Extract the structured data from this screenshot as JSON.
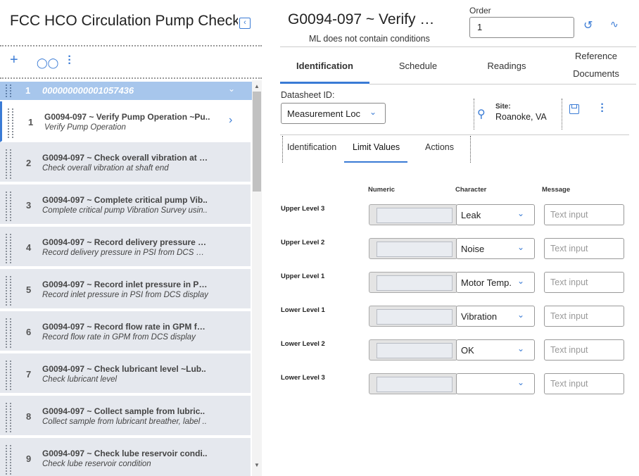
{
  "left_panel": {
    "title": "FCC HCO Circulation Pump Check…",
    "group": {
      "number": "1",
      "id": "000000000001057436"
    },
    "items": [
      {
        "number": "1",
        "title": "G0094-097 ~ Verify Pump Operation ~Pu..",
        "subtitle": "Verify Pump Operation"
      },
      {
        "number": "2",
        "title": "G0094-097 ~ Check overall vibration at s..",
        "subtitle": "Check overall vibration at shaft end"
      },
      {
        "number": "3",
        "title": "G0094-097 ~ Complete critical pump Vib..",
        "subtitle": "Complete critical pump Vibration Survey usin.."
      },
      {
        "number": "4",
        "title": "G0094-097 ~ Record delivery pressure in..",
        "subtitle": "Record delivery pressure in PSI from DCS disp.."
      },
      {
        "number": "5",
        "title": "G0094-097 ~ Record inlet pressure in PS..",
        "subtitle": "Record inlet pressure in PSI from DCS display"
      },
      {
        "number": "6",
        "title": "G0094-097 ~ Record flow rate in GPM fro..",
        "subtitle": "Record flow rate in GPM from DCS display"
      },
      {
        "number": "7",
        "title": "G0094-097 ~ Check lubricant level ~Lub..",
        "subtitle": "Check lubricant level"
      },
      {
        "number": "8",
        "title": "G0094-097 ~ Collect sample from lubric..",
        "subtitle": "Collect sample from lubricant breather, label .."
      },
      {
        "number": "9",
        "title": "G0094-097 ~ Check lube reservoir condi..",
        "subtitle": "Check lube reservoir condition"
      }
    ]
  },
  "header": {
    "title": "G0094-097 ~ Verify …",
    "subtitle": "ML does not contain conditions",
    "order_label": "Order",
    "order_value": "1"
  },
  "main_tabs": [
    "Identification",
    "Schedule",
    "Readings",
    "Reference",
    "Documents"
  ],
  "datasheet": {
    "label": "Datasheet ID:",
    "value": "Measurement Loc",
    "site_label": "Site:",
    "site_value": "Roanoke, VA"
  },
  "sub_tabs": [
    "Identification",
    "Limit Values",
    "Actions"
  ],
  "limits": {
    "col_numeric": "Numeric",
    "col_character": "Character",
    "col_message": "Message",
    "message_placeholder": "Text input",
    "rows": [
      {
        "label": "Upper Level 3",
        "character": "Leak"
      },
      {
        "label": "Upper Level 2",
        "character": "Noise"
      },
      {
        "label": "Upper Level 1",
        "character": "Motor Temp."
      },
      {
        "label": "Lower Level 1",
        "character": "Vibration"
      },
      {
        "label": "Lower Level 2",
        "character": "OK"
      },
      {
        "label": "Lower Level 3",
        "character": ""
      }
    ]
  },
  "colors": {
    "accent": "#3a7bd5",
    "group_bg": "#a7c6ec",
    "row_bg": "#e5e8ee"
  }
}
